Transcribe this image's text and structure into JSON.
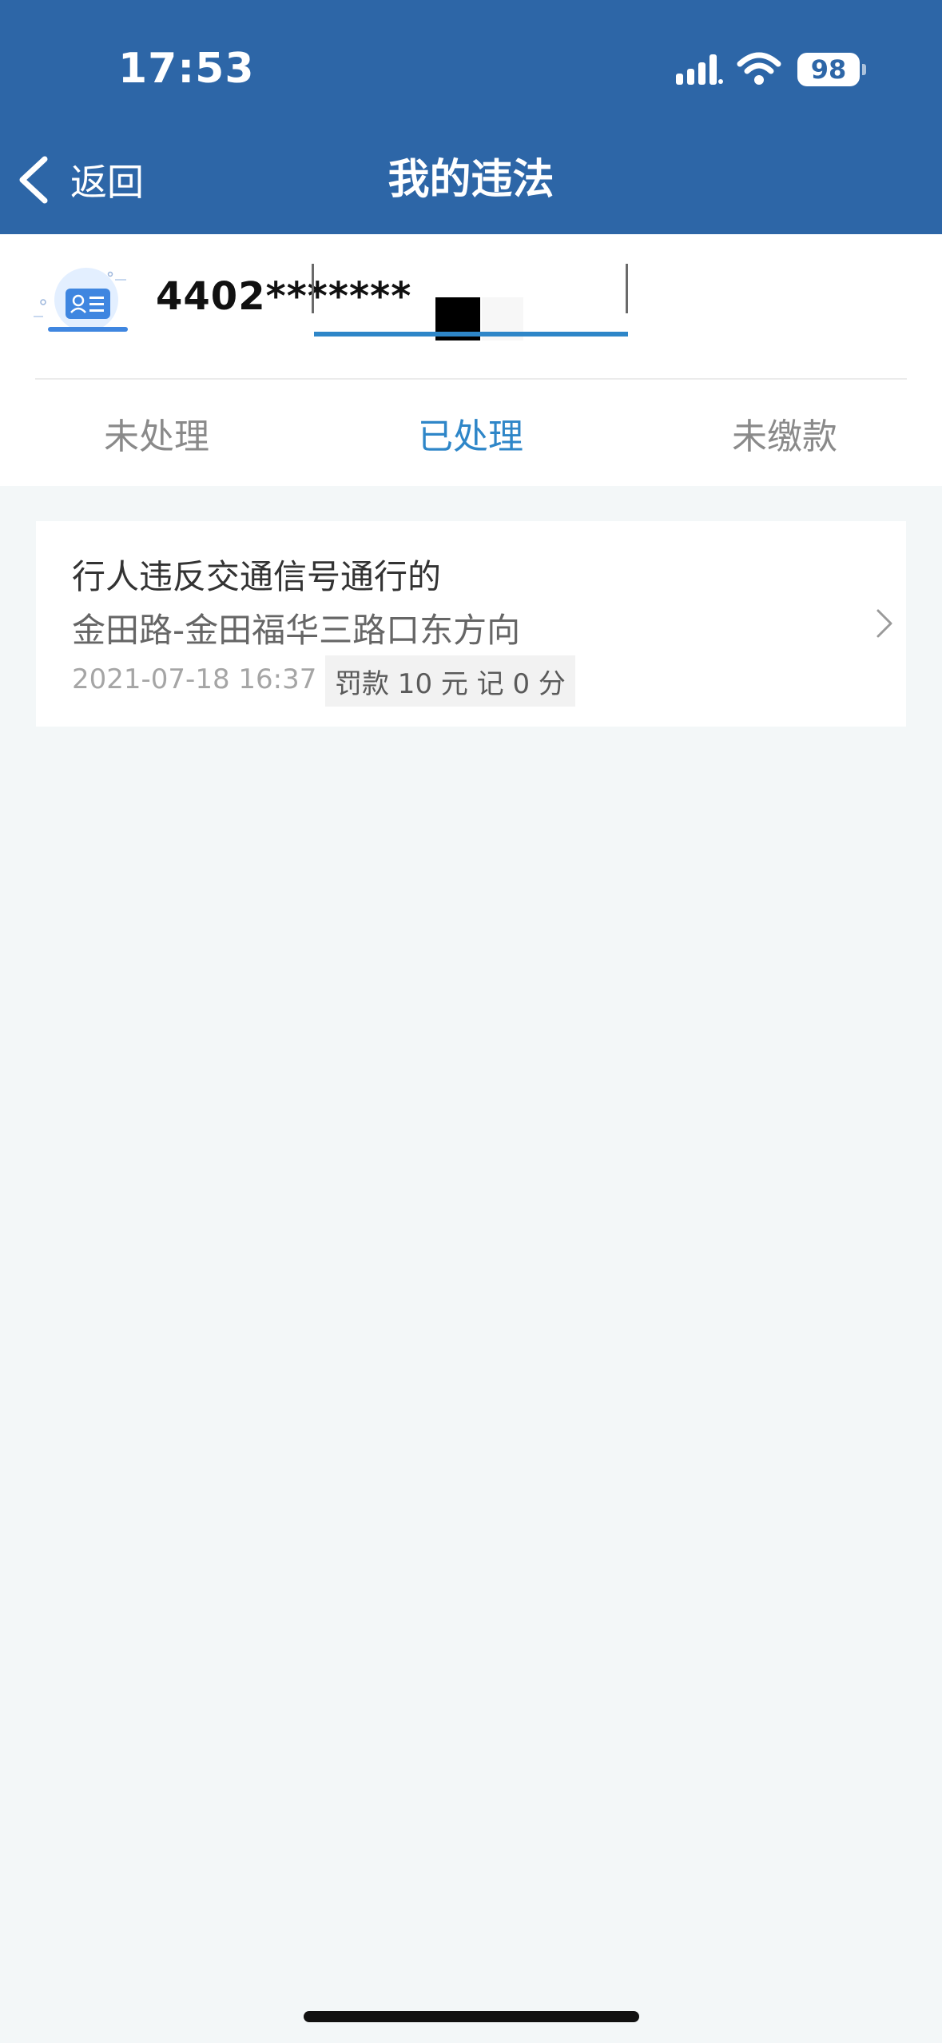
{
  "status_bar": {
    "time": "17:53",
    "battery": "98"
  },
  "nav": {
    "back_label": "返回",
    "title": "我的违法"
  },
  "license": {
    "id_number": "4402*******"
  },
  "tabs": [
    {
      "label": "未处理",
      "active": false
    },
    {
      "label": "已处理",
      "active": true
    },
    {
      "label": "未缴款",
      "active": false
    }
  ],
  "records": [
    {
      "violation": "行人违反交通信号通行的",
      "location": "金田路-金田福华三路口东方向",
      "time": "2021-07-18 16:37",
      "penalty": "罚款 10 元 记 0 分"
    }
  ],
  "colors": {
    "header": "#2d66a7",
    "accent": "#2e86c8",
    "background": "#f3f7f8"
  },
  "icons": {
    "back": "chevron-left-icon",
    "id_card": "id-card-icon",
    "signal": "cellular-signal-icon",
    "wifi": "wifi-icon",
    "battery": "battery-icon",
    "record_chevron": "chevron-right-icon"
  }
}
